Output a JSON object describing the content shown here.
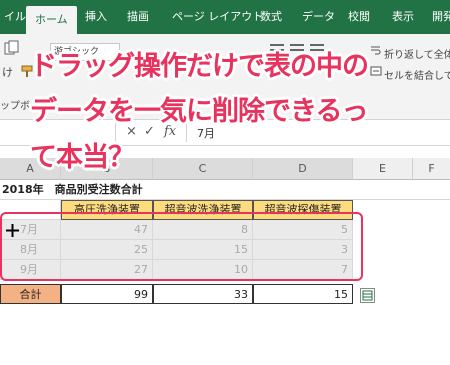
{
  "ribbon_tabs": [
    "イル",
    "ホーム",
    "挿入",
    "描画",
    "ページ レイアウト",
    "数式",
    "データ",
    "校閲",
    "表示",
    "開発"
  ],
  "ribbon": {
    "font_name": "游ゴシック",
    "paste_label": "け",
    "clipboard_label": "ップボード",
    "wrap_text": "折り返して全体",
    "merge_center": "セルを結合して"
  },
  "formula_bar": {
    "cancel": "×",
    "enter": "✓",
    "function": "fx",
    "value": "7月"
  },
  "sheet": {
    "columns": [
      "A",
      "B",
      "C",
      "D",
      "E",
      "F"
    ],
    "title": "2018年　商品別受注数合計",
    "headers": [
      "高圧洗浄装置",
      "超音波洗浄装置",
      "超音波探傷装置"
    ],
    "rows": [
      {
        "month": "7月",
        "values": [
          47,
          8,
          5
        ]
      },
      {
        "month": "8月",
        "values": [
          25,
          15,
          3
        ]
      },
      {
        "month": "9月",
        "values": [
          27,
          10,
          7
        ]
      }
    ],
    "total": {
      "label": "合計",
      "values": [
        99,
        33,
        15
      ]
    }
  },
  "caption": {
    "line1": "ドラッグ操作だけで表の中の",
    "line2": "データを一気に削除できるっ",
    "line3": "て本当？"
  },
  "colors": {
    "excel_green": "#217346",
    "caption_pink": "#e8335e",
    "header_fill": "#fddc7e",
    "total_fill": "#f4b183"
  }
}
